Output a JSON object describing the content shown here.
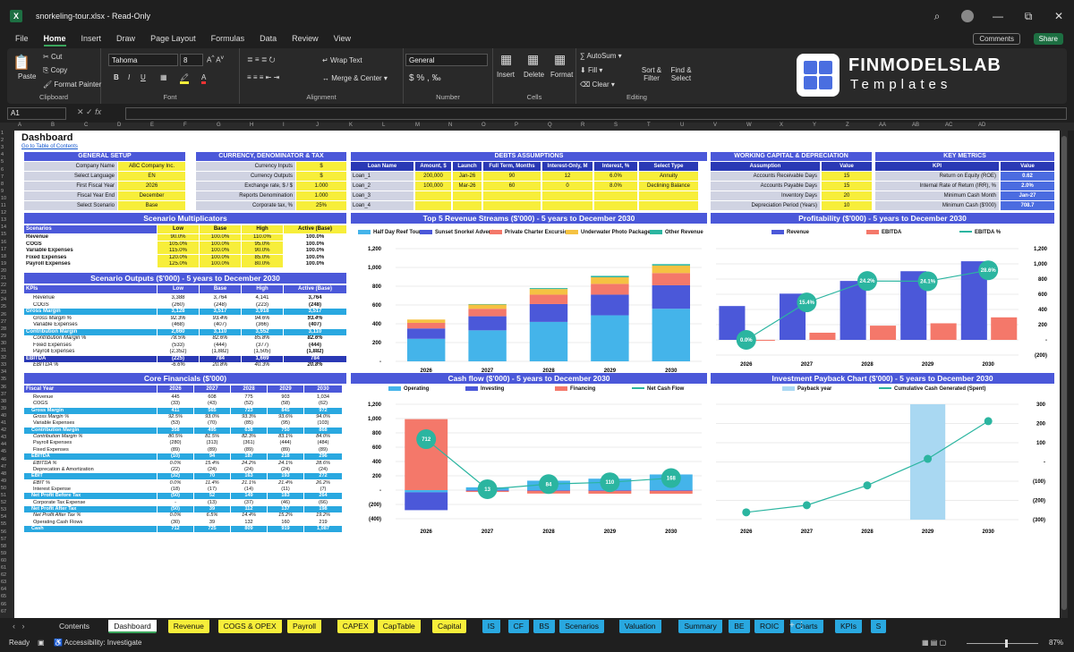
{
  "window": {
    "title": "snorkeling-tour.xlsx  -  Read-Only"
  },
  "menu": [
    "File",
    "Home",
    "Insert",
    "Draw",
    "Page Layout",
    "Formulas",
    "Data",
    "Review",
    "View"
  ],
  "buttons": {
    "comments": "Comments",
    "share": "Share"
  },
  "ribbon": {
    "clipboard": {
      "paste": "Paste",
      "cut": "Cut",
      "copy": "Copy",
      "format_painter": "Format Painter",
      "label": "Clipboard"
    },
    "font": {
      "name": "Tahoma",
      "size": "8",
      "label": "Font"
    },
    "alignment": {
      "wrap": "Wrap Text",
      "merge": "Merge & Center",
      "label": "Alignment"
    },
    "number": {
      "format": "General",
      "label": "Number"
    },
    "cells": {
      "insert": "Insert",
      "delete": "Delete",
      "format": "Format",
      "label": "Cells"
    },
    "editing": {
      "autosum": "AutoSum",
      "fill": "Fill",
      "clear": "Clear",
      "sort": "Sort & Filter",
      "find": "Find & Select",
      "label": "Editing"
    }
  },
  "logo": {
    "name": "FINMODELSLAB",
    "sub": "Templates"
  },
  "formula_bar": {
    "cell": "A1",
    "fx": "fx",
    "value": ""
  },
  "sheet": {
    "title": "Dashboard",
    "toc_link": "Go to Table of Contents"
  },
  "general_setup": {
    "title": "GENERAL SETUP",
    "rows": [
      [
        "Company Name",
        "ABC Company Inc."
      ],
      [
        "Select Language",
        "EN"
      ],
      [
        "First Fiscal Year",
        "2026"
      ],
      [
        "Fiscal Year End",
        "December"
      ],
      [
        "Select Scenario",
        "Base"
      ]
    ]
  },
  "currency": {
    "title": "CURRENCY, DENOMINATOR & TAX",
    "rows": [
      [
        "Currency Inputs",
        "$"
      ],
      [
        "Currency Outputs",
        "$"
      ],
      [
        "Exchange rate, $ / $",
        "1.000"
      ],
      [
        "Reports Denomination",
        "1.000"
      ],
      [
        "Corporate tax, %",
        "25%"
      ]
    ]
  },
  "debts": {
    "title": "DEBTS ASSUMPTIONS",
    "headers": [
      "Loan Name",
      "Amount, $",
      "Launch",
      "Full Term, Months",
      "Interest-Only, M",
      "Interest, %",
      "Select Type"
    ],
    "rows": [
      [
        "Loan_1",
        "200,000",
        "Jan-26",
        "90",
        "12",
        "6.0%",
        "Annuity"
      ],
      [
        "Loan_2",
        "100,000",
        "Mar-26",
        "60",
        "0",
        "8.0%",
        "Declining Balance"
      ],
      [
        "Loan_3",
        "",
        "",
        "",
        "",
        "",
        ""
      ],
      [
        "Loan_4",
        "",
        "",
        "",
        "",
        "",
        ""
      ]
    ]
  },
  "working_capital": {
    "title": "WORKING CAPITAL & DEPRECIATION",
    "headers": [
      "Assumption",
      "Value"
    ],
    "rows": [
      [
        "Accounts Receivable Days",
        "15"
      ],
      [
        "Accounts Payable Days",
        "15"
      ],
      [
        "Inventory Days",
        "20"
      ],
      [
        "Depreciation Period (Years)",
        "10"
      ]
    ]
  },
  "key_metrics": {
    "title": "KEY METRICS",
    "headers": [
      "KPI",
      "Value"
    ],
    "rows": [
      [
        "Return on Equity (ROE)",
        "0.62"
      ],
      [
        "Internal Rate of Return (IRR), %",
        "2.0%"
      ],
      [
        "Minimum Cash Month",
        "Jan-27"
      ],
      [
        "Minimum Cash ($'000)",
        "708.7"
      ]
    ]
  },
  "scenario_mult": {
    "title": "Scenario Multiplicators",
    "headers": [
      "Scenarios",
      "Low",
      "Base",
      "High",
      "Active (Base)"
    ],
    "rows": [
      [
        "Revenue",
        "90.0%",
        "100.0%",
        "110.0%",
        "100.0%"
      ],
      [
        "COGS",
        "105.0%",
        "100.0%",
        "95.0%",
        "100.0%"
      ],
      [
        "Variable Expenses",
        "115.0%",
        "100.0%",
        "90.0%",
        "100.0%"
      ],
      [
        "Fixed Expenses",
        "120.0%",
        "100.0%",
        "85.0%",
        "100.0%"
      ],
      [
        "Payroll Expenses",
        "125.0%",
        "100.0%",
        "80.0%",
        "100.0%"
      ]
    ]
  },
  "scenario_out": {
    "title": "Scenario Outputs ($'000) - 5 years to December 2030",
    "headers": [
      "KPIs",
      "Low",
      "Base",
      "High",
      "Active (Base)"
    ],
    "rows": [
      {
        "s": "n",
        "c": [
          "Revenue",
          "3,388",
          "3,764",
          "4,141",
          "3,764"
        ]
      },
      {
        "s": "n",
        "c": [
          "COGS",
          "(260)",
          "(248)",
          "(223)",
          "(248)"
        ]
      },
      {
        "s": "h",
        "c": [
          "Gross Margin",
          "3,128",
          "3,517",
          "3,918",
          "3,517"
        ]
      },
      {
        "s": "i",
        "c": [
          "Gross Margin %",
          "92.3%",
          "93.4%",
          "94.6%",
          "93.4%"
        ]
      },
      {
        "s": "n",
        "c": [
          "Variable Expenses",
          "(468)",
          "(407)",
          "(366)",
          "(407)"
        ]
      },
      {
        "s": "h",
        "c": [
          "Contribution Margin",
          "2,660",
          "3,110",
          "3,552",
          "3,110"
        ]
      },
      {
        "s": "i",
        "c": [
          "Contribution Margin %",
          "78.5%",
          "82.6%",
          "85.8%",
          "82.6%"
        ]
      },
      {
        "s": "n",
        "c": [
          "Fixed Expenses",
          "(533)",
          "(444)",
          "(377)",
          "(444)"
        ]
      },
      {
        "s": "n",
        "c": [
          "Payroll Expenses",
          "(2,352)",
          "(1,882)",
          "(1,505)",
          "(1,882)"
        ]
      },
      {
        "s": "d",
        "c": [
          "EBITDA",
          "(225)",
          "784",
          "1,669",
          "784"
        ]
      },
      {
        "s": "i",
        "c": [
          "EBITDA %",
          "-6.6%",
          "20.8%",
          "40.3%",
          "20.8%"
        ]
      }
    ]
  },
  "core": {
    "title": "Core Financials ($'000)",
    "headers": [
      "Fiscal Year",
      "2026",
      "2027",
      "2028",
      "2029",
      "2030"
    ],
    "rows": [
      {
        "s": "n",
        "c": [
          "Revenue",
          "445",
          "608",
          "775",
          "903",
          "1,034"
        ]
      },
      {
        "s": "n",
        "c": [
          "COGS",
          "(33)",
          "(43)",
          "(52)",
          "(58)",
          "(62)"
        ]
      },
      {
        "s": "h",
        "c": [
          "Gross Margin",
          "411",
          "565",
          "723",
          "845",
          "972"
        ]
      },
      {
        "s": "i",
        "c": [
          "Gross Margin %",
          "92.5%",
          "93.0%",
          "93.3%",
          "93.6%",
          "94.0%"
        ]
      },
      {
        "s": "n",
        "c": [
          "Variable Expenses",
          "(53)",
          "(70)",
          "(85)",
          "(95)",
          "(103)"
        ]
      },
      {
        "s": "h",
        "c": [
          "Contribution Margin",
          "358",
          "495",
          "638",
          "750",
          "868"
        ]
      },
      {
        "s": "i",
        "c": [
          "Contribution Margin %",
          "80.5%",
          "81.5%",
          "82.3%",
          "83.1%",
          "84.0%"
        ]
      },
      {
        "s": "n",
        "c": [
          "Payroll Expenses",
          "(280)",
          "(313)",
          "(361)",
          "(444)",
          "(484)"
        ]
      },
      {
        "s": "n",
        "c": [
          "Fixed Expenses",
          "(89)",
          "(89)",
          "(89)",
          "(89)",
          "(89)"
        ]
      },
      {
        "s": "h",
        "c": [
          "EBITDA",
          "(10)",
          "94",
          "187",
          "218",
          "296"
        ]
      },
      {
        "s": "i",
        "c": [
          "EBITDA %",
          "0.0%",
          "15.4%",
          "24.2%",
          "24.1%",
          "28.6%"
        ]
      },
      {
        "s": "n",
        "c": [
          "Deprecation & Amortization",
          "(22)",
          "(24)",
          "(24)",
          "(24)",
          "(24)"
        ]
      },
      {
        "s": "h",
        "c": [
          "EBIT",
          "(32)",
          "70",
          "163",
          "193",
          "272"
        ]
      },
      {
        "s": "i",
        "c": [
          "EBIT %",
          "0.0%",
          "11.4%",
          "21.1%",
          "21.4%",
          "26.2%"
        ]
      },
      {
        "s": "n",
        "c": [
          "Interest Expense",
          "(18)",
          "(17)",
          "(14)",
          "(11)",
          "(7)"
        ]
      },
      {
        "s": "h",
        "c": [
          "Net Profit Before Tax",
          "(50)",
          "52",
          "149",
          "183",
          "264"
        ]
      },
      {
        "s": "n",
        "c": [
          "Corporate Tax Expense",
          "-",
          "(13)",
          "(37)",
          "(46)",
          "(66)"
        ]
      },
      {
        "s": "h",
        "c": [
          "Net Profit After Tax",
          "(50)",
          "39",
          "112",
          "137",
          "198"
        ]
      },
      {
        "s": "i",
        "c": [
          "Net Profit After Tax %",
          "0.0%",
          "6.5%",
          "14.4%",
          "15.2%",
          "19.2%"
        ]
      },
      {
        "s": "n",
        "c": [
          "Operating Cash Flows",
          "(30)",
          "39",
          "132",
          "160",
          "219"
        ]
      },
      {
        "s": "h",
        "c": [
          "Cash",
          "712",
          "725",
          "809",
          "919",
          "1,087"
        ]
      }
    ]
  },
  "chart_data": [
    {
      "type": "bar",
      "title": "Top 5 Revenue Streams ($'000) - 5 years to December 2030",
      "categories": [
        "2026",
        "2027",
        "2028",
        "2029",
        "2030"
      ],
      "series": [
        {
          "name": "Half Day Reef Tour",
          "values": [
            240,
            330,
            420,
            490,
            560
          ]
        },
        {
          "name": "Sunset Snorkel Adventure",
          "values": [
            110,
            150,
            190,
            220,
            250
          ]
        },
        {
          "name": "Private Charter Excursion",
          "values": [
            60,
            80,
            100,
            115,
            130
          ]
        },
        {
          "name": "Underwater Photo Packages",
          "values": [
            35,
            45,
            60,
            70,
            80
          ]
        },
        {
          "name": "Other Revenue",
          "values": [
            0,
            5,
            10,
            15,
            15
          ]
        }
      ],
      "ylim": [
        0,
        1200
      ],
      "colors": [
        "#44b4ea",
        "#4b58d9",
        "#f4786a",
        "#f5c242",
        "#2bb5a0"
      ]
    },
    {
      "type": "bar",
      "title": "Profitability ($'000) - 5 years to December 2030",
      "categories": [
        "2026",
        "2027",
        "2028",
        "2029",
        "2030"
      ],
      "series": [
        {
          "name": "Revenue",
          "values": [
            445,
            608,
            775,
            903,
            1034
          ]
        },
        {
          "name": "EBITDA",
          "values": [
            -10,
            94,
            187,
            218,
            296
          ]
        }
      ],
      "line": {
        "name": "EBITDA %",
        "values": [
          0.0,
          15.4,
          24.2,
          24.1,
          28.6
        ],
        "labels": [
          "0.0%",
          "15.4%",
          "24.2%",
          "24.1%",
          "28.6%"
        ]
      },
      "ylim": [
        -200,
        1200
      ],
      "yticks": [
        "(200)",
        "-",
        "200",
        "400",
        "600",
        "800",
        "1,000",
        "1,200"
      ],
      "colors": [
        "#4b58d9",
        "#f4786a",
        "#2bb5a0"
      ]
    },
    {
      "type": "bar",
      "title": "Cash flow ($'000) - 5 years to December 2030",
      "categories": [
        "2026",
        "2027",
        "2028",
        "2029",
        "2030"
      ],
      "series": [
        {
          "name": "Operating",
          "values": [
            -30,
            39,
            132,
            160,
            219
          ]
        },
        {
          "name": "Investing",
          "values": [
            -250,
            -10,
            -10,
            -10,
            -10
          ]
        },
        {
          "name": "Financing",
          "values": [
            992,
            -16,
            -38,
            -40,
            -41
          ]
        }
      ],
      "line": {
        "name": "Net Cash Flow",
        "values": [
          712,
          13,
          84,
          110,
          168
        ],
        "labels": [
          "712",
          "13",
          "84",
          "110",
          "168"
        ]
      },
      "ylim": [
        -400,
        1200
      ],
      "yticks": [
        "(400)",
        "(200)",
        "-",
        "200",
        "400",
        "600",
        "800",
        "1,000",
        "1,200"
      ],
      "colors": [
        "#44b4ea",
        "#4b58d9",
        "#f4786a",
        "#2bb5a0"
      ]
    },
    {
      "type": "line",
      "title": "Investment Payback Chart ($'000) - 5 years to December 2030",
      "categories": [
        "2026",
        "2027",
        "2028",
        "2029",
        "2030"
      ],
      "series": [
        {
          "name": "Payback year",
          "values": [
            0,
            0,
            0,
            1,
            0
          ]
        },
        {
          "name": "Cumulative Cash Generated (Spent)",
          "values": [
            -262,
            -225,
            -122,
            16,
            212
          ]
        }
      ],
      "ylim": [
        -300,
        300
      ],
      "yticks": [
        "(300)",
        "(200)",
        "(100)",
        "-",
        "100",
        "200",
        "300"
      ],
      "colors": [
        "#a9d8f2",
        "#2bb5a0"
      ]
    }
  ],
  "sheet_tabs": [
    {
      "label": "Contents",
      "k": "w"
    },
    {
      "label": "Dashboard",
      "k": "active"
    },
    {
      "label": "Revenue",
      "k": "y"
    },
    {
      "label": "COGS & OPEX",
      "k": "y"
    },
    {
      "label": "Payroll",
      "k": "y"
    },
    {
      "label": "CAPEX",
      "k": "y"
    },
    {
      "label": "CapTable",
      "k": "y"
    },
    {
      "label": "Capital",
      "k": "y"
    },
    {
      "label": "IS",
      "k": "b"
    },
    {
      "label": "CF",
      "k": "b"
    },
    {
      "label": "BS",
      "k": "b"
    },
    {
      "label": "Scenarios",
      "k": "b"
    },
    {
      "label": "Valuation",
      "k": "b"
    },
    {
      "label": "Summary",
      "k": "b"
    },
    {
      "label": "BE",
      "k": "b"
    },
    {
      "label": "ROIC",
      "k": "b"
    },
    {
      "label": "Charts",
      "k": "b"
    },
    {
      "label": "KPIs",
      "k": "b"
    },
    {
      "label": "S",
      "k": "b"
    }
  ],
  "status": {
    "ready": "Ready",
    "accessibility": "Accessibility: Investigate",
    "zoom": "87%"
  }
}
